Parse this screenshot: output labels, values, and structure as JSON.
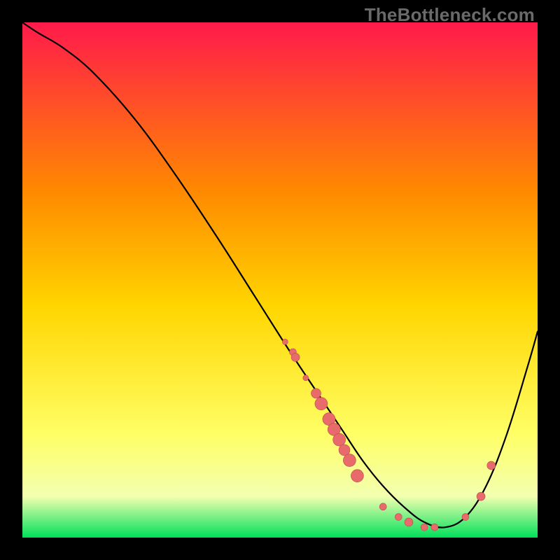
{
  "watermark": "TheBottleneck.com",
  "colors": {
    "gradient_top": "#ff1a4b",
    "gradient_mid1": "#ff8a00",
    "gradient_mid2": "#ffd500",
    "gradient_mid3": "#ffff66",
    "gradient_bottom": "#00e05a",
    "curve": "#000000",
    "dots": "#e86a6a",
    "dots_stroke": "#b94d4d"
  },
  "chart_data": {
    "type": "line",
    "title": "",
    "xlabel": "",
    "ylabel": "",
    "xlim": [
      0,
      100
    ],
    "ylim": [
      0,
      100
    ],
    "grid": false,
    "legend": false,
    "series": [
      {
        "name": "bottleneck-curve",
        "x": [
          0,
          3,
          8,
          14,
          22,
          30,
          38,
          45,
          52,
          58,
          62,
          66,
          70,
          74,
          78,
          82,
          86,
          90,
          94,
          98,
          100
        ],
        "y": [
          100,
          98,
          95,
          90,
          81,
          70,
          58,
          47,
          36,
          27,
          21,
          15,
          10,
          6,
          3,
          2,
          4,
          10,
          20,
          33,
          40
        ],
        "comment": "y is percent distance from the green trough (0) to red top (100)"
      }
    ],
    "dots": {
      "name": "data-points",
      "x": [
        51,
        52.5,
        53,
        55,
        57,
        58,
        59.5,
        60.5,
        61.5,
        62.5,
        63.5,
        65,
        70,
        73,
        75,
        78,
        80,
        86,
        89,
        91
      ],
      "y": [
        38,
        36,
        35,
        31,
        28,
        26,
        23,
        21,
        19,
        17,
        15,
        12,
        6,
        4,
        3,
        2,
        2,
        4,
        8,
        14
      ],
      "r": [
        4,
        5,
        6,
        4,
        7,
        9,
        9,
        9,
        9,
        8,
        9,
        9,
        5,
        5,
        6,
        5,
        5,
        5,
        6,
        6
      ]
    }
  }
}
